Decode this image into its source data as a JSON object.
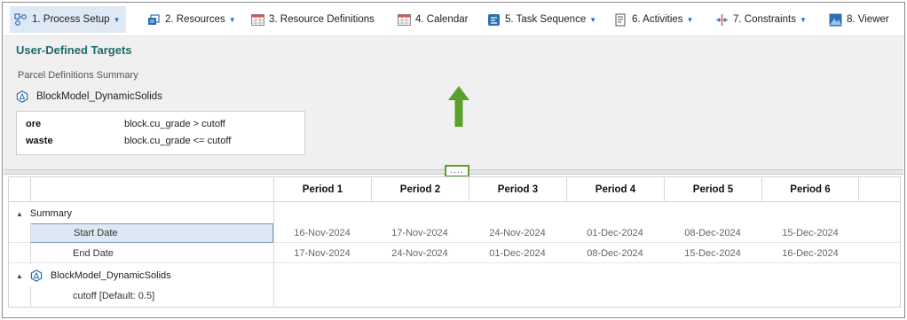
{
  "toolbar": {
    "items": [
      {
        "label": "1. Process Setup",
        "icon": "process-setup-icon",
        "dropdown": true,
        "active": true
      },
      {
        "label": "2. Resources",
        "icon": "resources-icon",
        "dropdown": true,
        "active": false
      },
      {
        "label": "3. Resource Definitions",
        "icon": "table-icon",
        "dropdown": false,
        "active": false
      },
      {
        "label": "4. Calendar",
        "icon": "calendar-icon",
        "dropdown": false,
        "active": false
      },
      {
        "label": "5. Task Sequence",
        "icon": "task-sequence-icon",
        "dropdown": true,
        "active": false
      },
      {
        "label": "6. Activities",
        "icon": "activities-icon",
        "dropdown": true,
        "active": false
      },
      {
        "label": "7. Constraints",
        "icon": "constraints-icon",
        "dropdown": true,
        "active": false
      },
      {
        "label": "8. Viewer",
        "icon": "viewer-icon",
        "dropdown": false,
        "active": false
      }
    ]
  },
  "upper": {
    "title": "User-Defined Targets",
    "subtitle": "Parcel Definitions Summary",
    "model_name": "BlockModel_DynamicSolids",
    "definitions": [
      {
        "key": "ore",
        "value": "block.cu_grade > cutoff"
      },
      {
        "key": "waste",
        "value": "block.cu_grade <= cutoff"
      }
    ]
  },
  "splitter": {
    "grip_text": "...."
  },
  "grid": {
    "periods": [
      "Period 1",
      "Period 2",
      "Period 3",
      "Period 4",
      "Period 5",
      "Period 6"
    ],
    "summary_group": "Summary",
    "rows": [
      {
        "label": "Start Date",
        "values": [
          "16-Nov-2024",
          "17-Nov-2024",
          "24-Nov-2024",
          "01-Dec-2024",
          "08-Dec-2024",
          "15-Dec-2024"
        ],
        "selected": true
      },
      {
        "label": "End Date",
        "values": [
          "17-Nov-2024",
          "24-Nov-2024",
          "01-Dec-2024",
          "08-Dec-2024",
          "15-Dec-2024",
          "16-Dec-2024"
        ],
        "selected": false
      }
    ],
    "model_group": "BlockModel_DynamicSolids",
    "model_rows": [
      {
        "label": "cutoff [Default: 0.5]"
      }
    ]
  },
  "colors": {
    "accent": "#2d6fb5",
    "title": "#1f6a6a",
    "highlight_arrow": "#5aa02c"
  }
}
